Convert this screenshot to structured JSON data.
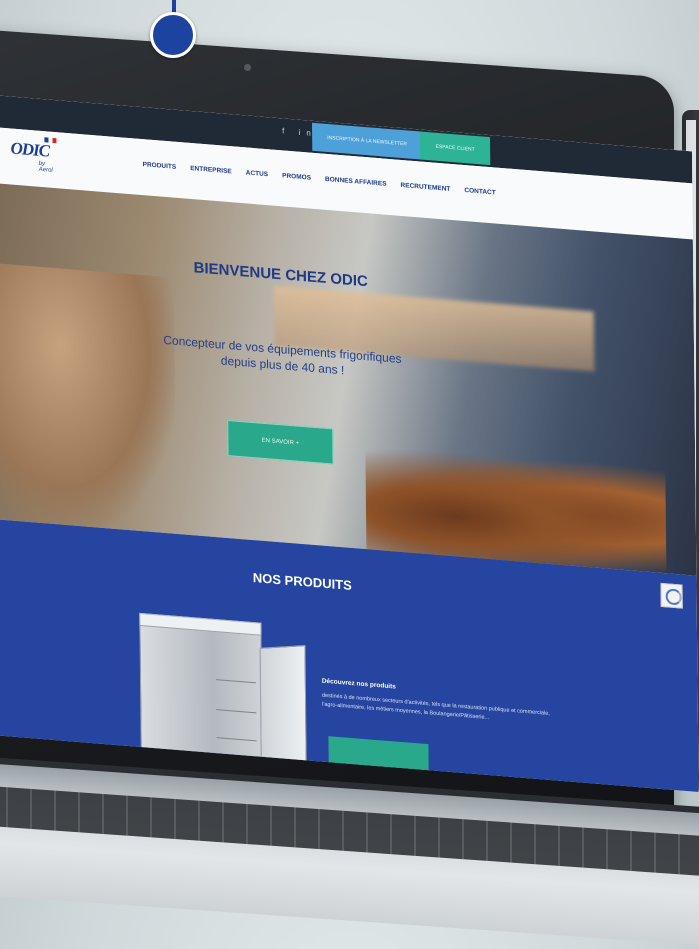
{
  "topbar": {
    "social": "f  in",
    "inscription": "Inscription à la newsletter",
    "espace_client": "Espace client"
  },
  "nav": {
    "logo": "ODIC",
    "logo_sub": "by Aerol",
    "items": [
      "PRODUITS",
      "ENTREPRISE",
      "ACTUS",
      "PROMOS",
      "BONNES AFFAIRES",
      "RECRUTEMENT",
      "CONTACT"
    ]
  },
  "hero": {
    "title": "BIENVENUE CHEZ ODIC",
    "subtitle": "Concepteur de vos équipements frigorifiques depuis plus de 40 ans !",
    "button": "EN SAVOIR +"
  },
  "produits": {
    "title": "NOS PRODUITS",
    "desc_title": "Découvrez nos produits",
    "desc_text": "destinés à de nombreux secteurs d'activités, tels que la restauration publique et commerciale, l'agro-alimentaire, les métiers moyennes, la Boulangerie/Pâtisserie..."
  },
  "colors": {
    "brand_blue": "#2545a0",
    "accent_teal": "#2aa88c",
    "newsletter_blue": "#4ea1d8"
  }
}
